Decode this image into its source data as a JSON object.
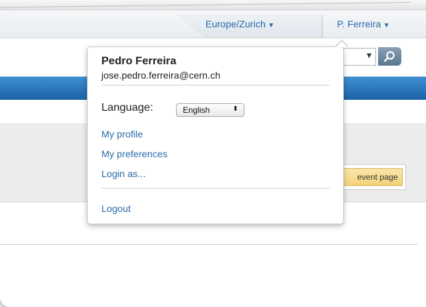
{
  "header": {
    "timezone": "Europe/Zurich",
    "user_short": "P. Ferreira"
  },
  "event_button": {
    "label": "event page"
  },
  "user_popup": {
    "name": "Pedro Ferreira",
    "email": "jose.pedro.ferreira@cern.ch",
    "language_label": "Language:",
    "language_value": "English",
    "links": [
      "My profile",
      "My preferences",
      "Login as..."
    ],
    "logout": "Logout"
  },
  "icons": {
    "search": "search-icon",
    "caret": "caret-down-icon",
    "select_arrows": "select-arrows-icon"
  },
  "colors": {
    "link": "#2a6aa8",
    "blue_bar": "#1b63a6",
    "event_button": "#f3d27a"
  }
}
